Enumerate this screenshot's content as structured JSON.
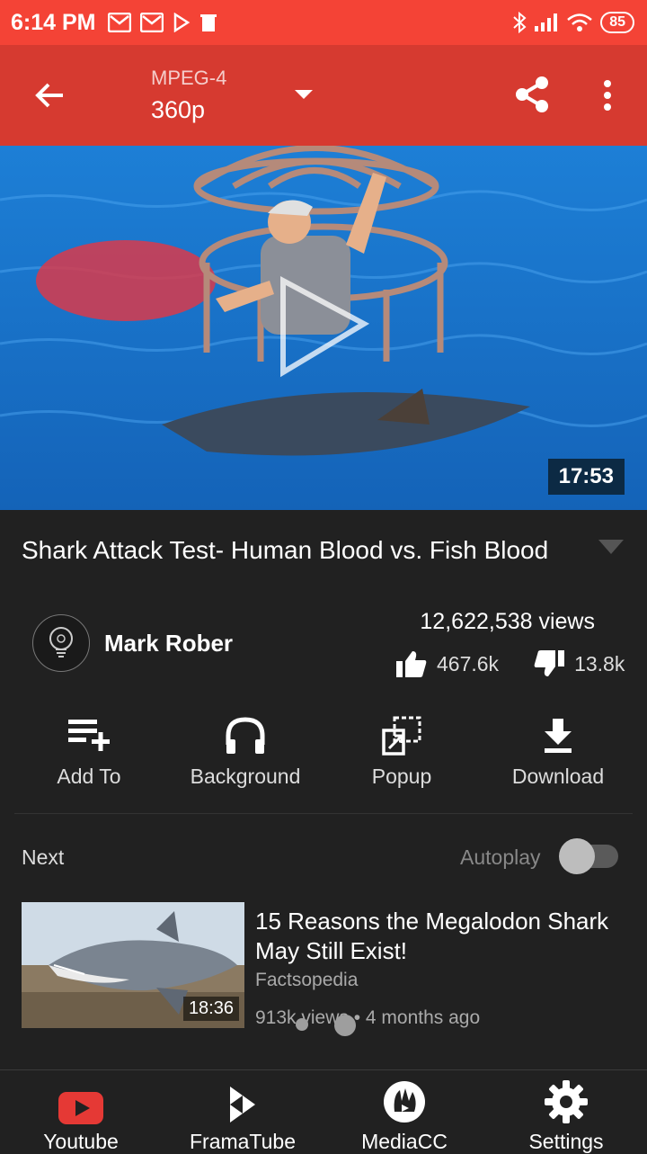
{
  "status": {
    "time": "6:14 PM",
    "battery": "85"
  },
  "toolbar": {
    "format": "MPEG-4",
    "resolution": "360p"
  },
  "video": {
    "duration": "17:53",
    "title": "Shark Attack Test- Human Blood vs. Fish Blood"
  },
  "channel": {
    "name": "Mark Rober"
  },
  "stats": {
    "views": "12,622,538 views",
    "likes": "467.6k",
    "dislikes": "13.8k"
  },
  "actions": [
    {
      "label": "Add To",
      "icon": "playlist-add-icon"
    },
    {
      "label": "Background",
      "icon": "headphones-icon"
    },
    {
      "label": "Popup",
      "icon": "popup-icon"
    },
    {
      "label": "Download",
      "icon": "download-icon"
    }
  ],
  "next_section": {
    "label": "Next",
    "autoplay_label": "Autoplay",
    "autoplay_on": false
  },
  "related": {
    "title": "15 Reasons the Megalodon Shark May Still Exist!",
    "channel": "Factsopedia",
    "meta": "913k views • 4 months ago",
    "duration": "18:36"
  },
  "bottom_nav": [
    {
      "label": "Youtube",
      "icon": "youtube-icon"
    },
    {
      "label": "FramaTube",
      "icon": "framatube-icon"
    },
    {
      "label": "MediaCC",
      "icon": "mediacc-icon"
    },
    {
      "label": "Settings",
      "icon": "gear-icon"
    }
  ],
  "colors": {
    "statusbar": "#f44336",
    "appbar": "#d63a30",
    "background": "#212121"
  }
}
